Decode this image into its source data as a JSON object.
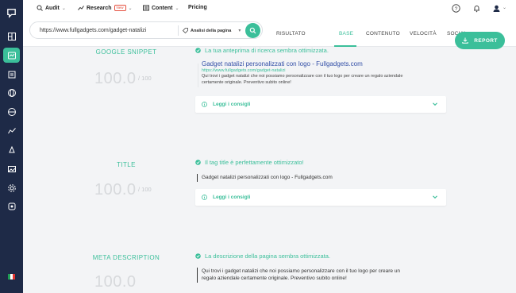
{
  "nav": {
    "audit": "Audit",
    "research": "Research",
    "research_badge": "New",
    "content": "Content",
    "pricing": "Pricing"
  },
  "toolbar": {
    "url_value": "https://www.fullgadgets.com/gadget-natalizi",
    "analysis_mode": "Analisi della pagina",
    "tabs": [
      "RISULTATO",
      "BASE",
      "CONTENUTO",
      "VELOCITÀ",
      "SOCIAL"
    ],
    "active_tab": "BASE",
    "report_label": "REPORT"
  },
  "sections": {
    "snippet": {
      "title": "GOOGLE SNIPPET",
      "score": "100.0",
      "score_max": "/ 100",
      "status": "La tua anteprima di ricerca sembra ottimizzata.",
      "preview_title": "Gadget natalizi personalizzati con logo - Fullgadgets.com",
      "preview_url": "https://www.fullgadgets.com/gadget-natalizi",
      "preview_desc": "Qui trovi i gadget natalizi che noi possiamo personalizzare con il tuo logo per creare un regalo aziendale certamente originale. Preventivo subito online!",
      "advice": "Leggi i consigli"
    },
    "title": {
      "title": "TITLE",
      "score": "100.0",
      "score_max": "/ 100",
      "status": "Il tag title è perfettamente ottimizzato!",
      "value": "Gadget natalizi personalizzati con logo - Fullgadgets.com",
      "advice": "Leggi i consigli"
    },
    "meta": {
      "title": "META DESCRIPTION",
      "score": "100.0",
      "status": "La descrizione della pagina sembra ottimizzata.",
      "value_line1": "Qui trovi i gadget natalizi che noi possiamo personalizzare con il tuo logo per creare un",
      "value_line2": "regalo aziendale certamente originale. Preventivo subito online!"
    }
  },
  "colors": {
    "accent": "#3bbf9a",
    "sidebar": "#1e2a47",
    "link": "#3551a8"
  }
}
